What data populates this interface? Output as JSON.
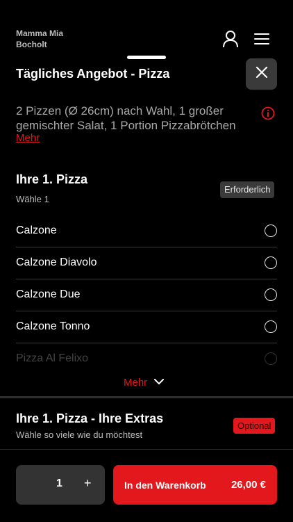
{
  "header": {
    "restaurant_line1": "Mamma Mia",
    "restaurant_line2": "Bocholt",
    "user_icon": "user-icon",
    "menu_icon": "hamburger-menu-icon"
  },
  "sheet": {
    "title": "Tägliches Angebot - Pizza",
    "close_icon": "close-icon",
    "description": "2 Pizzen (Ø 26cm) nach Wahl, 1 großer gemischter Salat, 1 Portion Pizzabrötchen",
    "info_icon": "info-icon",
    "more_link": "Mehr"
  },
  "section1": {
    "title": "Ihre 1. Pizza",
    "subtitle": "Wähle 1",
    "badge": "Erforderlich",
    "options": [
      "Calzone",
      "Calzone Diavolo",
      "Calzone Due",
      "Calzone Tonno",
      "Pizza Al Felixo"
    ],
    "more_label": "Mehr",
    "more_icon": "chevron-down-icon"
  },
  "section2": {
    "title": "Ihre 1. Pizza - Ihre Extras",
    "subtitle": "Wähle so viele wie du möchtest",
    "badge": "Optional"
  },
  "footer": {
    "quantity": "1",
    "plus": "+",
    "add_to_cart": "In den Warenkorb",
    "price": "26,00 €"
  },
  "colors": {
    "accent": "#e3181c",
    "background": "#000000",
    "surface": "#3a3a3a"
  }
}
